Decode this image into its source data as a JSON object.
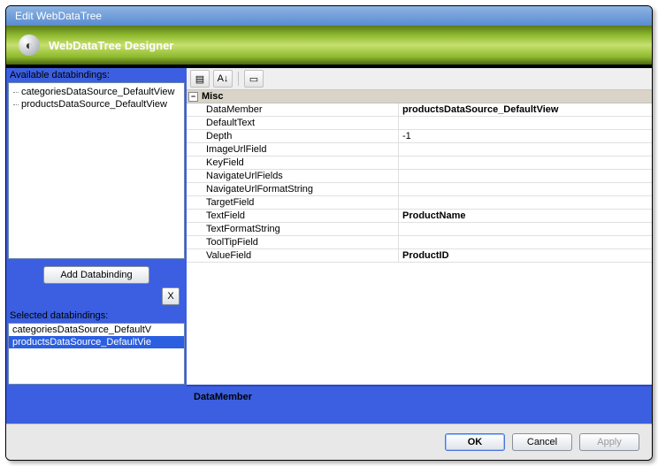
{
  "titlebar": {
    "title": "Edit WebDataTree"
  },
  "designer": {
    "title": "WebDataTree Designer"
  },
  "sidebar": {
    "available_label": "Available databindings:",
    "available_items": [
      "categoriesDataSource_DefaultView",
      "productsDataSource_DefaultView"
    ],
    "add_button_label": "Add Databinding",
    "delete_button_label": "X",
    "selected_label": "Selected databindings:",
    "selected_items": [
      {
        "text": "categoriesDataSource_DefaultV",
        "selected": false
      },
      {
        "text": "productsDataSource_DefaultVie",
        "selected": true
      }
    ]
  },
  "propgrid": {
    "category": "Misc",
    "rows": [
      {
        "name": "DataMember",
        "value": "productsDataSource_DefaultView",
        "bold": true
      },
      {
        "name": "DefaultText",
        "value": ""
      },
      {
        "name": "Depth",
        "value": "-1"
      },
      {
        "name": "ImageUrlField",
        "value": ""
      },
      {
        "name": "KeyField",
        "value": ""
      },
      {
        "name": "NavigateUrlFields",
        "value": ""
      },
      {
        "name": "NavigateUrlFormatString",
        "value": ""
      },
      {
        "name": "TargetField",
        "value": ""
      },
      {
        "name": "TextField",
        "value": "ProductName",
        "bold": true
      },
      {
        "name": "TextFormatString",
        "value": ""
      },
      {
        "name": "ToolTipField",
        "value": ""
      },
      {
        "name": "ValueField",
        "value": "ProductID",
        "bold": true
      }
    ],
    "description_title": "DataMember"
  },
  "buttons": {
    "ok": "OK",
    "cancel": "Cancel",
    "apply": "Apply"
  }
}
